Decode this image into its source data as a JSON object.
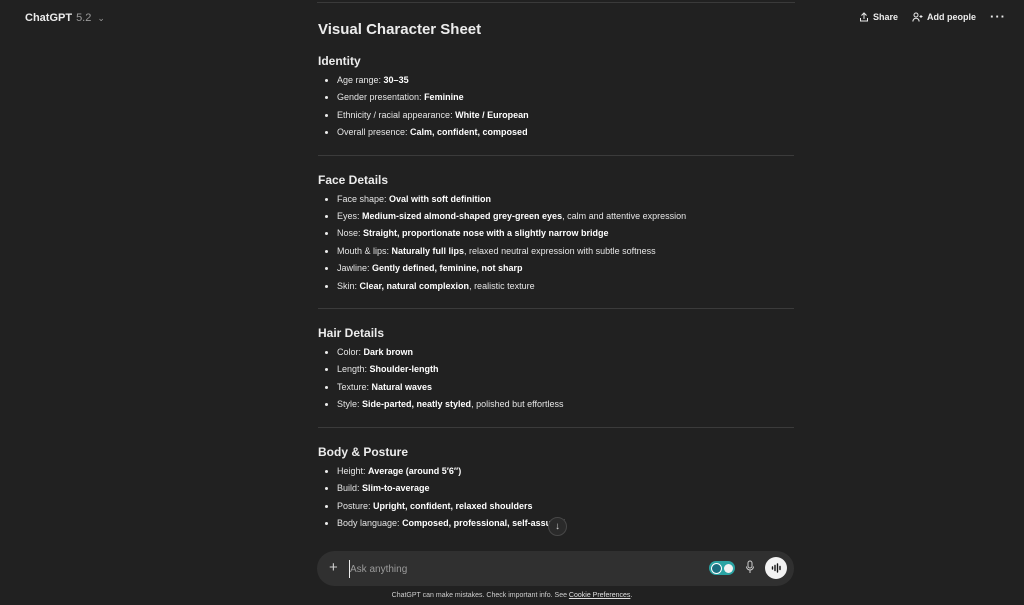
{
  "header": {
    "model_name": "ChatGPT",
    "model_version": "5.2",
    "share_label": "Share",
    "add_people_label": "Add people",
    "more_label": "···"
  },
  "doc": {
    "title": "Visual Character Sheet",
    "sections": [
      {
        "heading": "Identity",
        "items": [
          {
            "pre": "Age range: ",
            "bold": "30–35",
            "post": ""
          },
          {
            "pre": "Gender presentation: ",
            "bold": "Feminine",
            "post": ""
          },
          {
            "pre": "Ethnicity / racial appearance: ",
            "bold": "White / European",
            "post": ""
          },
          {
            "pre": "Overall presence: ",
            "bold": "Calm, confident, composed",
            "post": ""
          }
        ]
      },
      {
        "heading": "Face Details",
        "items": [
          {
            "pre": "Face shape: ",
            "bold": "Oval with soft definition",
            "post": ""
          },
          {
            "pre": "Eyes: ",
            "bold": "Medium-sized almond-shaped grey-green eyes",
            "post": ", calm and attentive expression"
          },
          {
            "pre": "Nose: ",
            "bold": "Straight, proportionate nose with a slightly narrow bridge",
            "post": ""
          },
          {
            "pre": "Mouth & lips: ",
            "bold": "Naturally full lips",
            "post": ", relaxed neutral expression with subtle softness"
          },
          {
            "pre": "Jawline: ",
            "bold": "Gently defined, feminine, not sharp",
            "post": ""
          },
          {
            "pre": "Skin: ",
            "bold": "Clear, natural complexion",
            "post": ", realistic texture"
          }
        ]
      },
      {
        "heading": "Hair Details",
        "items": [
          {
            "pre": "Color: ",
            "bold": "Dark brown",
            "post": ""
          },
          {
            "pre": "Length: ",
            "bold": "Shoulder-length",
            "post": ""
          },
          {
            "pre": "Texture: ",
            "bold": "Natural waves",
            "post": ""
          },
          {
            "pre": "Style: ",
            "bold": "Side-parted, neatly styled",
            "post": ", polished but effortless"
          }
        ]
      },
      {
        "heading": "Body & Posture",
        "items": [
          {
            "pre": "Height: ",
            "bold": "Average (around 5′6″)",
            "post": ""
          },
          {
            "pre": "Build: ",
            "bold": "Slim-to-average",
            "post": ""
          },
          {
            "pre": "Posture: ",
            "bold": "Upright, confident, relaxed shoulders",
            "post": ""
          },
          {
            "pre": "Body language: ",
            "bold": "Composed, professional, self-assured",
            "post": ""
          }
        ]
      }
    ]
  },
  "composer": {
    "placeholder": "Ask anything",
    "extension_colors": [
      "#2aa3a3",
      "#1b6f80"
    ]
  },
  "footer": {
    "text": "ChatGPT can make mistakes. Check important info. See ",
    "link": "Cookie Preferences",
    "end": "."
  },
  "colors": {
    "background": "#212121",
    "composer": "#303030",
    "text": "#ececec"
  }
}
